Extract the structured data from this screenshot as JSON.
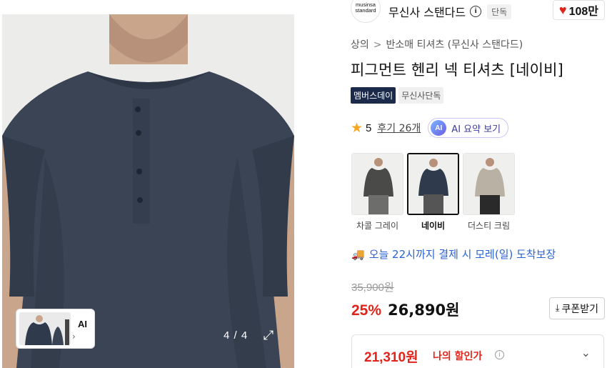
{
  "gallery": {
    "ai_label": "AI",
    "ai_arrow": "›",
    "counter": "4 / 4",
    "expand_icon": "⤢"
  },
  "brand": {
    "logo_line1": "musinsa",
    "logo_line2": "standard",
    "name": "무신사 스탠다드",
    "info_icon": "i",
    "exclusive_badge": "단독",
    "like_count": "108만"
  },
  "breadcrumb": {
    "category": "상의",
    "separator": ">",
    "subcategory": "반소매 티셔츠 (무신사 스탠다드)"
  },
  "product": {
    "title": "피그먼트 헨리 넥 티셔츠 [네이비]",
    "tags": [
      "멤버스데이",
      "무신사단독"
    ]
  },
  "rating": {
    "score": "5",
    "reviews": "후기 26개",
    "ai_badge": "AI",
    "ai_summary": "AI 요약 보기"
  },
  "colors": [
    {
      "name": "차콜 그레이",
      "selected": false,
      "hex": "#4a4a48"
    },
    {
      "name": "네이비",
      "selected": true,
      "hex": "#2f3b4d"
    },
    {
      "name": "더스티 크림",
      "selected": false,
      "hex": "#b9b2a4"
    }
  ],
  "delivery": {
    "text": "오늘 22시까지 결제 시 모레(일) 도착보장"
  },
  "price": {
    "original": "35,900원",
    "discount": "25%",
    "sale": "26,890원",
    "coupon_button": "쿠폰받기",
    "my_price": "21,310원",
    "my_price_label": "나의 할인가",
    "help_icon": "i",
    "chevron": "⌄"
  },
  "theme": {
    "accent_red": "#e2231a",
    "delivery_blue": "#2a63d4",
    "shirt_navy": "#3a4454"
  }
}
